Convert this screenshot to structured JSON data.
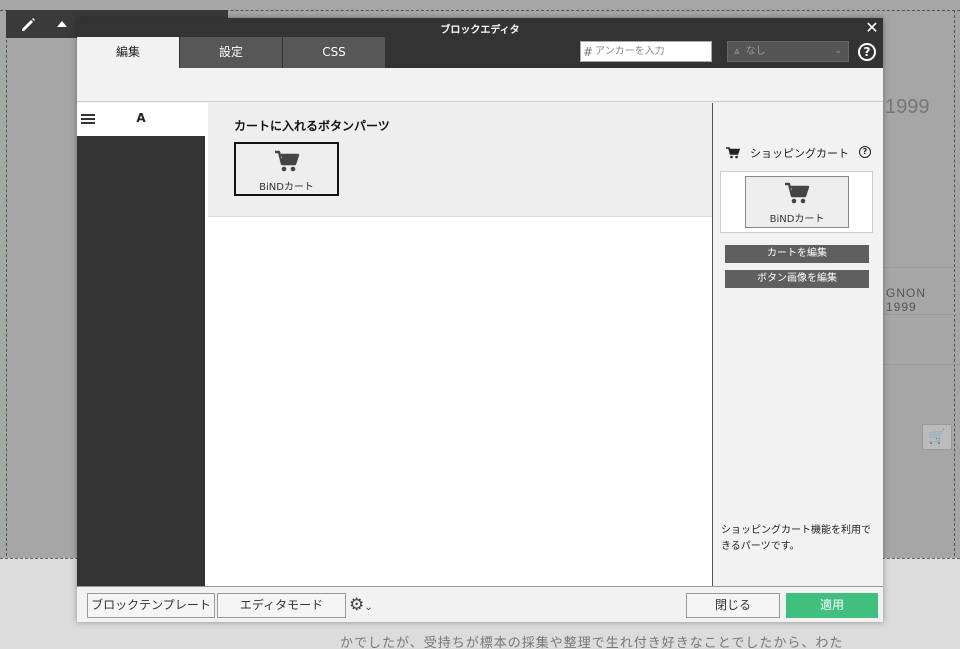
{
  "background": {
    "year_text": "1999",
    "gnon_text": "GNON 1999",
    "bottom_text": "かでしたが、受持ちが標本の採集や整理で生れ付き好きなことでしたから、わた"
  },
  "dialog": {
    "title": "ブロックエディタ",
    "close_glyph": "✕",
    "tabs": [
      {
        "label": "編集",
        "active": true
      },
      {
        "label": "設定",
        "active": false
      },
      {
        "label": "CSS",
        "active": false
      }
    ],
    "anchor": {
      "hash": "#",
      "placeholder": "アンカーを入力"
    },
    "select": {
      "value": "なし"
    },
    "help_glyph": "?"
  },
  "leftnav": {
    "label": "A"
  },
  "content": {
    "heading": "カートに入れるボタンパーツ",
    "cart_button_label": "BiNDカート"
  },
  "rightpanel": {
    "title": "ショッピングカート",
    "help_glyph": "?",
    "preview_label": "BiNDカート",
    "edit_cart_label": "カートを編集",
    "edit_image_label": "ボタン画像を編集",
    "note": "ショッピングカート機能を利用できるパーツです。"
  },
  "footer": {
    "block_template_label": "ブロックテンプレート",
    "editor_mode_label": "エディタモード",
    "close_label": "閉じる",
    "apply_label": "適用"
  },
  "colors": {
    "titlebar": "#333333",
    "apply": "#3fc07f",
    "leftnav": "#333333"
  }
}
